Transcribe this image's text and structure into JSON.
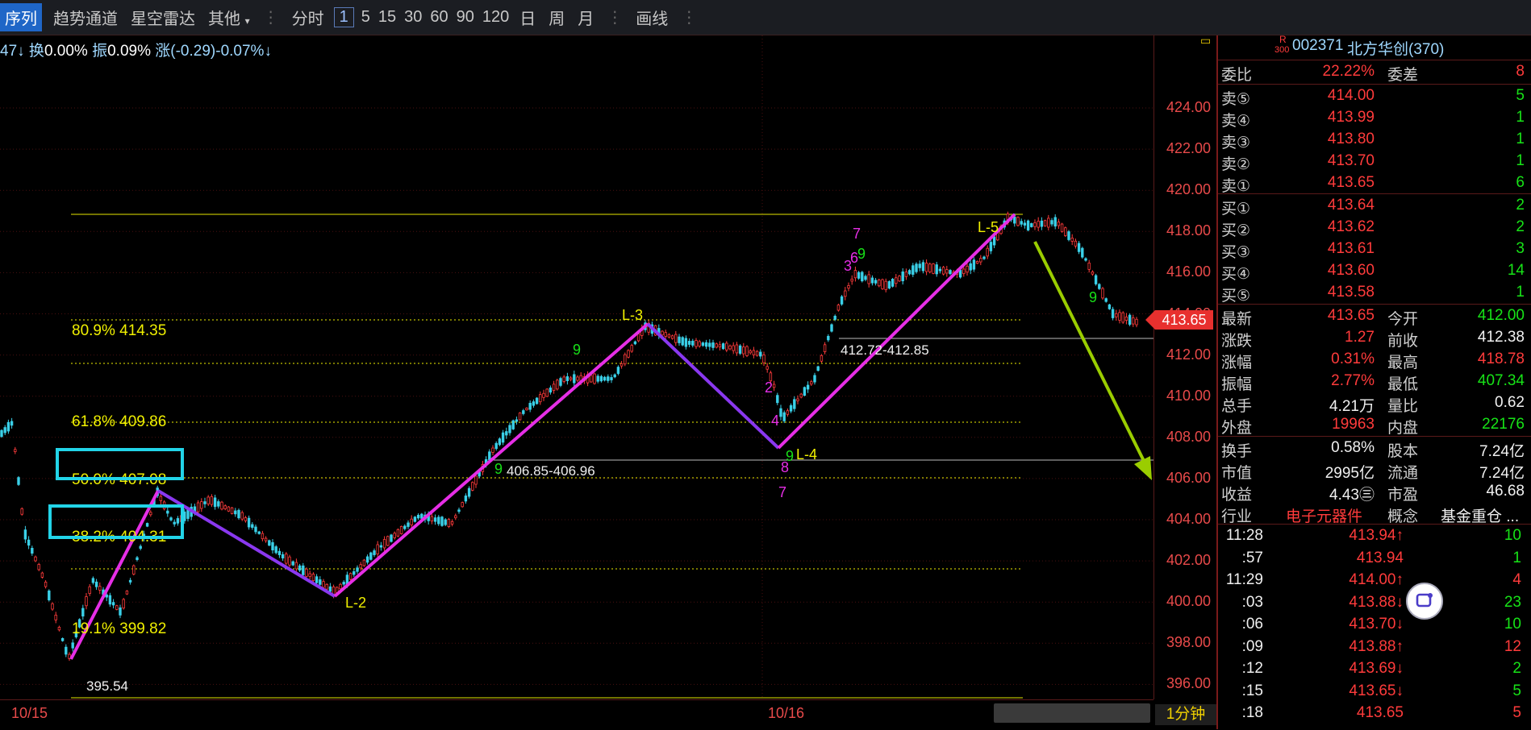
{
  "toolbar": {
    "items": [
      "序列",
      "趋势通道",
      "星空雷达",
      "其他",
      "分时",
      "1",
      "5",
      "15",
      "30",
      "60",
      "90",
      "120",
      "日",
      "周",
      "月",
      "画线"
    ]
  },
  "infobar": {
    "prefix": "47↓",
    "turnover_label": "换",
    "turnover_value": "0.00%",
    "amp_label": "振",
    "amp_value": "0.09%",
    "chg_label": "涨",
    "chg_value": "(-0.29)-0.07%↓"
  },
  "price_axis": [
    "424.00",
    "422.00",
    "420.00",
    "418.00",
    "416.00",
    "414.00",
    "412.00",
    "410.00",
    "408.00",
    "406.00",
    "404.00",
    "402.00",
    "400.00",
    "398.00",
    "396.00"
  ],
  "current_price_tag": "413.65",
  "dates": [
    "10/15",
    "10/16"
  ],
  "period": "1分钟",
  "fib_labels": [
    {
      "text": "80.9% 414.35"
    },
    {
      "text": "61.8% 409.86"
    },
    {
      "text": "50.0% 407.08"
    },
    {
      "text": "38.2% 404.31"
    },
    {
      "text": "19.1% 399.82"
    }
  ],
  "wave_labels": [
    "L-2",
    "L-3",
    "L-4",
    "L-5"
  ],
  "price_notes": [
    "395.54",
    "406.85-406.96",
    "412.72-412.85"
  ],
  "td_counts": [
    "9",
    "9",
    "9",
    "9",
    "7",
    "7",
    "9",
    "3",
    "6",
    "2",
    "4",
    "8"
  ],
  "colors": {
    "bg": "#000000",
    "up": "#ff3b3b",
    "down": "#3ad0e8",
    "wave_up": "#e62ee6",
    "wave_down": "#8a38f0",
    "fib": "#f0f000",
    "arrow": "#9acd00"
  },
  "panel": {
    "r_mark": "R",
    "index_mark": "300",
    "code": "002371",
    "name": "北方华创(370)",
    "weibi_label": "委比",
    "weibi": "22.22%",
    "weicha_label": "委差",
    "weicha": "8",
    "asks": [
      {
        "label": "卖⑤",
        "price": "414.00",
        "vol": "5"
      },
      {
        "label": "卖④",
        "price": "413.99",
        "vol": "1"
      },
      {
        "label": "卖③",
        "price": "413.80",
        "vol": "1"
      },
      {
        "label": "卖②",
        "price": "413.70",
        "vol": "1"
      },
      {
        "label": "卖①",
        "price": "413.65",
        "vol": "6"
      }
    ],
    "bids": [
      {
        "label": "买①",
        "price": "413.64",
        "vol": "2"
      },
      {
        "label": "买②",
        "price": "413.62",
        "vol": "2"
      },
      {
        "label": "买③",
        "price": "413.61",
        "vol": "3"
      },
      {
        "label": "买④",
        "price": "413.60",
        "vol": "14"
      },
      {
        "label": "买⑤",
        "price": "413.58",
        "vol": "1"
      }
    ],
    "stats": [
      {
        "l1": "最新",
        "v1": "413.65",
        "c1": "red",
        "l2": "今开",
        "v2": "412.00",
        "c2": "grn"
      },
      {
        "l1": "涨跌",
        "v1": "1.27",
        "c1": "red",
        "l2": "前收",
        "v2": "412.38",
        "c2": "wht"
      },
      {
        "l1": "涨幅",
        "v1": "0.31%",
        "c1": "red",
        "l2": "最高",
        "v2": "418.78",
        "c2": "red"
      },
      {
        "l1": "振幅",
        "v1": "2.77%",
        "c1": "red",
        "l2": "最低",
        "v2": "407.34",
        "c2": "grn"
      },
      {
        "l1": "总手",
        "v1": "4.21万",
        "c1": "wht",
        "l2": "量比",
        "v2": "0.62",
        "c2": "wht"
      },
      {
        "l1": "外盘",
        "v1": "19963",
        "c1": "red",
        "l2": "内盘",
        "v2": "22176",
        "c2": "grn"
      }
    ],
    "stats2": [
      {
        "l1": "换手",
        "v1": "0.58%",
        "l2": "股本",
        "v2": "7.24亿"
      },
      {
        "l1": "市值",
        "v1": "2995亿",
        "l2": "流通",
        "v2": "7.24亿"
      },
      {
        "l1": "收益",
        "v1": "4.43㊂",
        "l2": "市盈",
        "v2": "46.68"
      }
    ],
    "industry_label": "行业",
    "industry": "电子元器件",
    "concept_label": "概念",
    "concept": "基金重仓 ...",
    "ticks": [
      {
        "t": "11:28",
        "p": "413.94↑",
        "pc": "red",
        "v": "10",
        "vc": "grn"
      },
      {
        "t": ":57",
        "p": "413.94",
        "pc": "red",
        "v": "1",
        "vc": "grn"
      },
      {
        "t": "11:29",
        "p": "414.00↑",
        "pc": "red",
        "v": "4",
        "vc": "red"
      },
      {
        "t": ":03",
        "p": "413.88↓",
        "pc": "red",
        "v": "23",
        "vc": "grn"
      },
      {
        "t": ":06",
        "p": "413.70↓",
        "pc": "red",
        "v": "10",
        "vc": "grn"
      },
      {
        "t": ":09",
        "p": "413.88↑",
        "pc": "red",
        "v": "12",
        "vc": "red"
      },
      {
        "t": ":12",
        "p": "413.69↓",
        "pc": "red",
        "v": "2",
        "vc": "grn"
      },
      {
        "t": ":15",
        "p": "413.65↓",
        "pc": "red",
        "v": "5",
        "vc": "grn"
      },
      {
        "t": ":18",
        "p": "413.65",
        "pc": "red",
        "v": "5",
        "vc": "red"
      }
    ]
  }
}
